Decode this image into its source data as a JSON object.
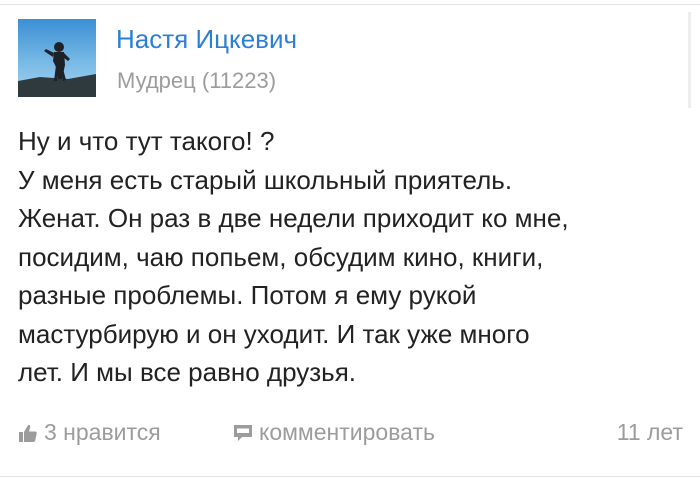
{
  "post": {
    "author": {
      "name": "Настя Ицкевич",
      "rank": "Мудрец (11223)",
      "avatar_icon": "user-avatar"
    },
    "body_lines": [
      "Ну и что тут такого! ?",
      "У меня есть старый школьный приятель.",
      "Женат. Он раз в две недели приходит ко мне,",
      "посидим, чаю попьем, обсудим кино, книги,",
      "разные проблемы. Потом я ему рукой",
      "мастурбирую и он уходит. И так уже много",
      "лет. И мы все равно друзья."
    ],
    "actions": {
      "like_label": "3 нравится",
      "like_icon": "thumbs-up-icon",
      "comment_label": "комментировать",
      "comment_icon": "comment-icon"
    },
    "timestamp": "11 лет"
  },
  "colors": {
    "author_link": "#2c7fd6",
    "secondary_text": "#9c9c9c",
    "body_text": "#222222",
    "divider": "#e3e3e3"
  }
}
